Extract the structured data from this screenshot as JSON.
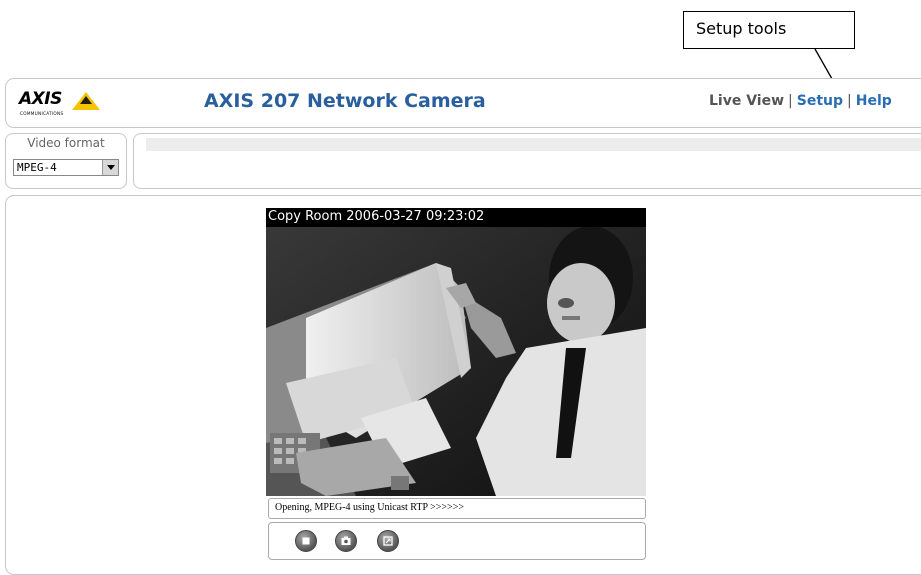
{
  "callout": {
    "label": "Setup tools"
  },
  "header": {
    "logo_text": "AXIS",
    "logo_subtext": "COMMUNICATIONS",
    "title": "AXIS 207 Network Camera",
    "nav": {
      "live_view": "Live View",
      "separator": "|",
      "setup": "Setup",
      "help": "Help"
    }
  },
  "video_format": {
    "label": "Video format",
    "selected": "MPEG-4"
  },
  "video": {
    "overlay_text": "Copy Room  2006-03-27 09:23:02",
    "status_text": "Opening, MPEG-4 using Unicast RTP >>>>>>"
  },
  "controls": [
    {
      "icon": "stop-icon"
    },
    {
      "icon": "snapshot-icon"
    },
    {
      "icon": "view-full-screen-icon"
    }
  ],
  "colors": {
    "title_blue": "#2a5f9e",
    "link_blue": "#2a6db5",
    "logo_yellow": "#f5c400"
  }
}
